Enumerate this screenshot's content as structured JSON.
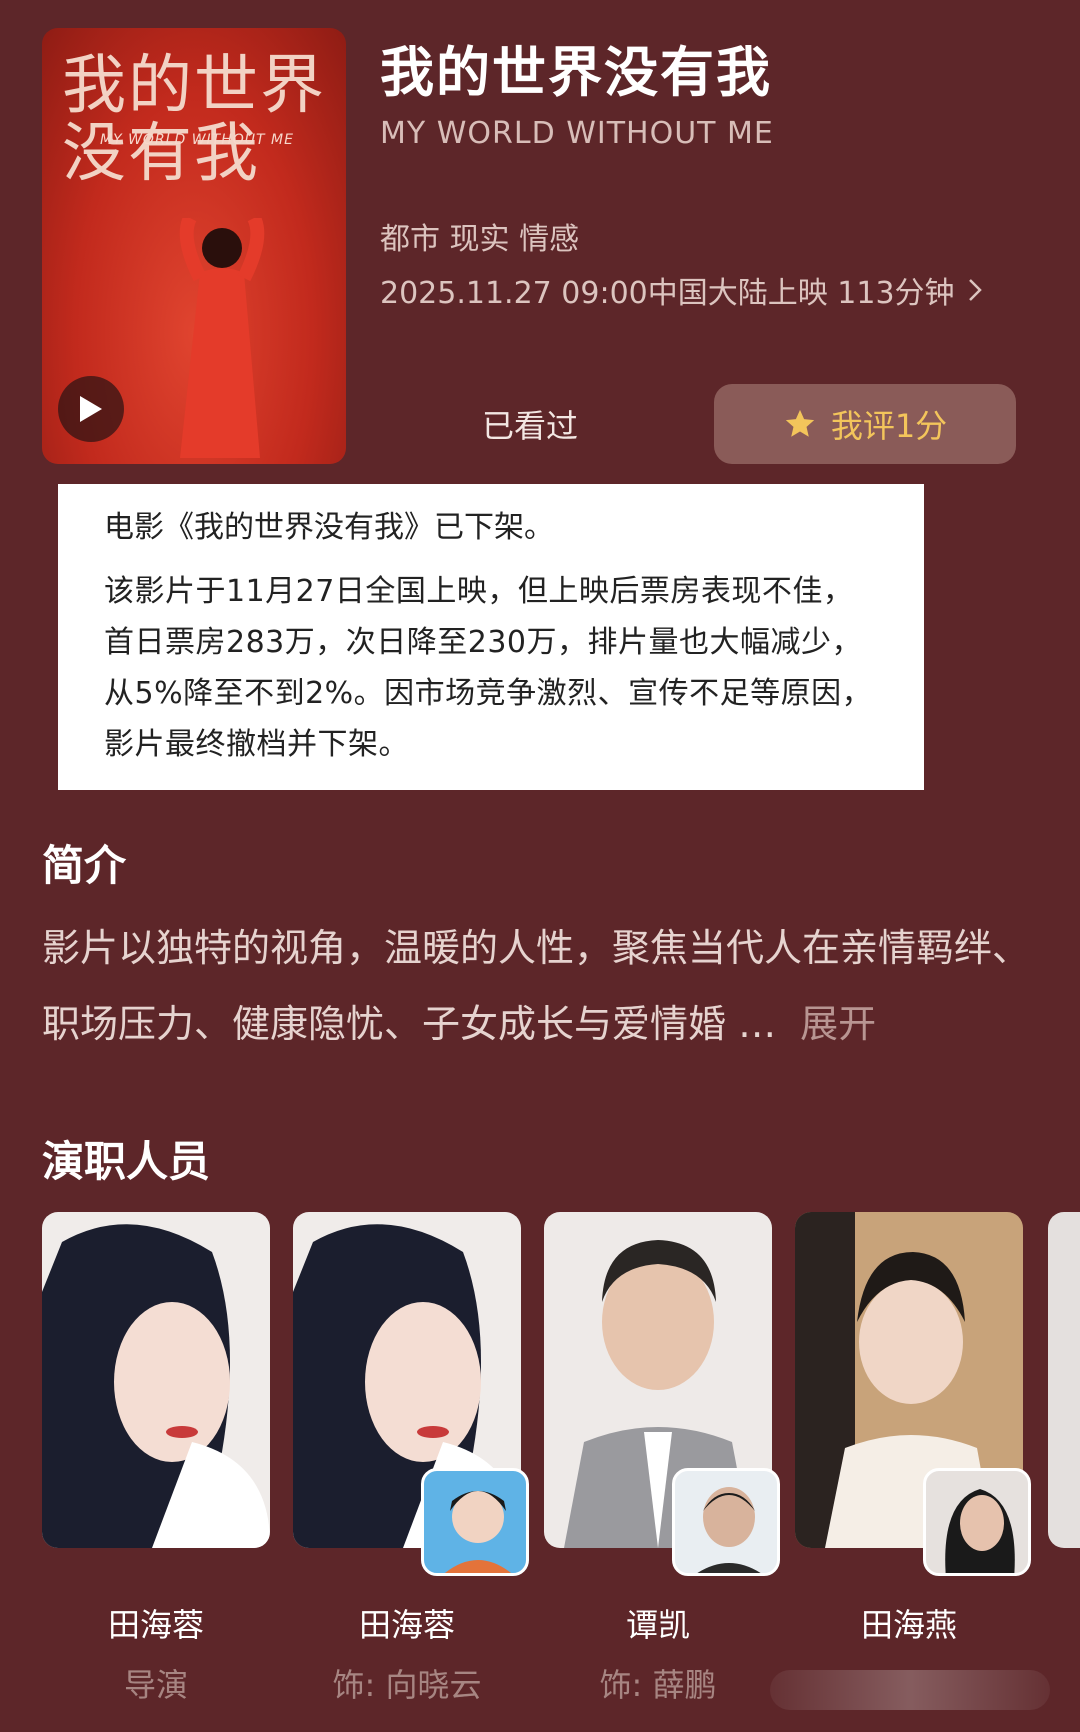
{
  "header": {
    "poster_title": "我的世界没有我",
    "poster_subtitle": "MY WORLD WITHOUT ME",
    "title": "我的世界没有我",
    "english_title": "MY WORLD WITHOUT ME",
    "genres": "都市 现实 情感",
    "release_info": "2025.11.27 09:00中国大陆上映 113分钟",
    "watched_label": "已看过",
    "rate_label": "我评1分"
  },
  "notice": {
    "title": "电影《我的世界没有我》已下架。",
    "body": "该影片于11月27日全国上映，但上映后票房表现不佳，首日票房283万，次日降至230万，排片量也大幅减少，从5%降至不到2%。因市场竞争激烈、宣传不足等原因，影片最终撤档并下架。"
  },
  "intro": {
    "heading": "简介",
    "text": "影片以独特的视角，温暖的人性，聚焦当代人在亲情羁绊、职场压力、健康隐忧、子女成长与爱情婚 …",
    "expand_label": "展开"
  },
  "cast": {
    "heading": "演职人员",
    "members": [
      {
        "name": "田海蓉",
        "role": "导演"
      },
      {
        "name": "田海蓉",
        "role": "饰: 向晓云"
      },
      {
        "name": "谭凯",
        "role": "饰: 薛鹏"
      },
      {
        "name": "田海燕",
        "role": ""
      }
    ]
  },
  "colors": {
    "background": "#5d2629",
    "accent": "#f3c55b",
    "rate_button": "#8a5b58"
  },
  "icons": [
    "play-icon",
    "chevron-right-icon",
    "star-icon"
  ]
}
